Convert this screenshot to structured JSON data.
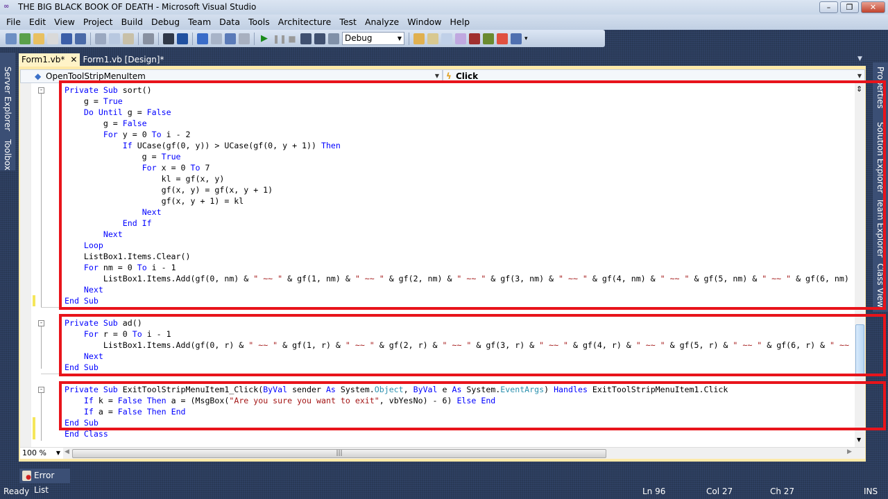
{
  "window": {
    "title": "THE BIG BLACK BOOK OF DEATH - Microsoft Visual Studio",
    "controls": [
      "minimize",
      "restore",
      "close"
    ]
  },
  "menu": [
    "File",
    "Edit",
    "View",
    "Project",
    "Build",
    "Debug",
    "Team",
    "Data",
    "Tools",
    "Architecture",
    "Test",
    "Analyze",
    "Window",
    "Help"
  ],
  "toolbar": {
    "configuration": "Debug"
  },
  "left_panels": [
    "Server Explorer",
    "Toolbox"
  ],
  "right_panels": [
    "Properties",
    "Solution Explorer",
    "Team Explorer",
    "Class View"
  ],
  "tabs": [
    {
      "label": "Form1.vb*",
      "active": true
    },
    {
      "label": "Form1.vb [Design]*",
      "active": false
    }
  ],
  "navbar": {
    "object": "OpenToolStripMenuItem",
    "event": "Click"
  },
  "colors": {
    "keyword": "#0000ff",
    "string": "#a31515",
    "type": "#2b91af",
    "highlight": "#e8141b"
  },
  "code": {
    "lines": [
      [
        [
          "Private Sub",
          "kw"
        ],
        [
          " sort()",
          ""
        ]
      ],
      [
        [
          "    g = ",
          ""
        ],
        [
          "True",
          "kw"
        ]
      ],
      [
        [
          "    ",
          ""
        ],
        [
          "Do Until",
          "kw"
        ],
        [
          " g = ",
          ""
        ],
        [
          "False",
          "kw"
        ]
      ],
      [
        [
          "        g = ",
          ""
        ],
        [
          "False",
          "kw"
        ]
      ],
      [
        [
          "        ",
          ""
        ],
        [
          "For",
          "kw"
        ],
        [
          " y = 0 ",
          ""
        ],
        [
          "To",
          "kw"
        ],
        [
          " i - 2",
          ""
        ]
      ],
      [
        [
          "            ",
          ""
        ],
        [
          "If",
          "kw"
        ],
        [
          " UCase(gf(0, y)) > UCase(gf(0, y + 1)) ",
          ""
        ],
        [
          "Then",
          "kw"
        ]
      ],
      [
        [
          "                g = ",
          ""
        ],
        [
          "True",
          "kw"
        ]
      ],
      [
        [
          "                ",
          ""
        ],
        [
          "For",
          "kw"
        ],
        [
          " x = 0 ",
          ""
        ],
        [
          "To",
          "kw"
        ],
        [
          " 7",
          ""
        ]
      ],
      [
        [
          "                    kl = gf(x, y)",
          ""
        ]
      ],
      [
        [
          "                    gf(x, y) = gf(x, y + 1)",
          ""
        ]
      ],
      [
        [
          "                    gf(x, y + 1) = kl",
          ""
        ]
      ],
      [
        [
          "                ",
          ""
        ],
        [
          "Next",
          "kw"
        ]
      ],
      [
        [
          "            ",
          ""
        ],
        [
          "End If",
          "kw"
        ]
      ],
      [
        [
          "        ",
          ""
        ],
        [
          "Next",
          "kw"
        ]
      ],
      [
        [
          "    ",
          ""
        ],
        [
          "Loop",
          "kw"
        ]
      ],
      [
        [
          "    ListBox1.Items.Clear()",
          ""
        ]
      ],
      [
        [
          "    ",
          ""
        ],
        [
          "For",
          "kw"
        ],
        [
          " nm = 0 ",
          ""
        ],
        [
          "To",
          "kw"
        ],
        [
          " i - 1",
          ""
        ]
      ],
      [
        [
          "        ListBox1.Items.Add(gf(0, nm) & ",
          ""
        ],
        [
          "\" ~~ \"",
          "str"
        ],
        [
          " & gf(1, nm) & ",
          ""
        ],
        [
          "\" ~~ \"",
          "str"
        ],
        [
          " & gf(2, nm) & ",
          ""
        ],
        [
          "\" ~~ \"",
          "str"
        ],
        [
          " & gf(3, nm) & ",
          ""
        ],
        [
          "\" ~~ \"",
          "str"
        ],
        [
          " & gf(4, nm) & ",
          ""
        ],
        [
          "\" ~~ \"",
          "str"
        ],
        [
          " & gf(5, nm) & ",
          ""
        ],
        [
          "\" ~~ \"",
          "str"
        ],
        [
          " & gf(6, nm)",
          ""
        ]
      ],
      [
        [
          "    ",
          ""
        ],
        [
          "Next",
          "kw"
        ]
      ],
      [
        [
          "End Sub",
          "kw"
        ]
      ],
      [],
      [
        [
          "Private Sub",
          "kw"
        ],
        [
          " ad()",
          ""
        ]
      ],
      [
        [
          "    ",
          ""
        ],
        [
          "For",
          "kw"
        ],
        [
          " r = 0 ",
          ""
        ],
        [
          "To",
          "kw"
        ],
        [
          " i - 1",
          ""
        ]
      ],
      [
        [
          "        ListBox1.Items.Add(gf(0, r) & ",
          ""
        ],
        [
          "\" ~~ \"",
          "str"
        ],
        [
          " & gf(1, r) & ",
          ""
        ],
        [
          "\" ~~ \"",
          "str"
        ],
        [
          " & gf(2, r) & ",
          ""
        ],
        [
          "\" ~~ \"",
          "str"
        ],
        [
          " & gf(3, r) & ",
          ""
        ],
        [
          "\" ~~ \"",
          "str"
        ],
        [
          " & gf(4, r) & ",
          ""
        ],
        [
          "\" ~~ \"",
          "str"
        ],
        [
          " & gf(5, r) & ",
          ""
        ],
        [
          "\" ~~ \"",
          "str"
        ],
        [
          " & gf(6, r) & ",
          ""
        ],
        [
          "\" ~~",
          "str"
        ]
      ],
      [
        [
          "    ",
          ""
        ],
        [
          "Next",
          "kw"
        ]
      ],
      [
        [
          "End Sub",
          "kw"
        ]
      ],
      [],
      [
        [
          "Private Sub",
          "kw"
        ],
        [
          " ExitToolStripMenuItem1_Click(",
          ""
        ],
        [
          "ByVal",
          "kw"
        ],
        [
          " sender ",
          ""
        ],
        [
          "As",
          "kw"
        ],
        [
          " System.",
          ""
        ],
        [
          "Object",
          "type"
        ],
        [
          ", ",
          ""
        ],
        [
          "ByVal",
          "kw"
        ],
        [
          " e ",
          ""
        ],
        [
          "As",
          "kw"
        ],
        [
          " System.",
          ""
        ],
        [
          "EventArgs",
          "type"
        ],
        [
          ") ",
          ""
        ],
        [
          "Handles",
          "kw"
        ],
        [
          " ExitToolStripMenuItem1.Click",
          ""
        ]
      ],
      [
        [
          "    ",
          ""
        ],
        [
          "If",
          "kw"
        ],
        [
          " k = ",
          ""
        ],
        [
          "False",
          "kw"
        ],
        [
          " ",
          ""
        ],
        [
          "Then",
          "kw"
        ],
        [
          " a = (MsgBox(",
          ""
        ],
        [
          "\"Are you sure you want to exit\"",
          "str"
        ],
        [
          ", vbYesNo) - 6) ",
          ""
        ],
        [
          "Else End",
          "kw"
        ]
      ],
      [
        [
          "    ",
          ""
        ],
        [
          "If",
          "kw"
        ],
        [
          " a = ",
          ""
        ],
        [
          "False",
          "kw"
        ],
        [
          " ",
          ""
        ],
        [
          "Then End",
          "kw"
        ]
      ],
      [
        [
          "End Sub",
          "kw"
        ]
      ],
      [
        [
          "End Class",
          "kw"
        ]
      ]
    ]
  },
  "editor": {
    "zoom": "100 %"
  },
  "bottom_tabs": [
    "Error List"
  ],
  "status": {
    "text": "Ready",
    "line": "Ln 96",
    "col": "Col 27",
    "ch": "Ch 27",
    "mode": "INS"
  }
}
